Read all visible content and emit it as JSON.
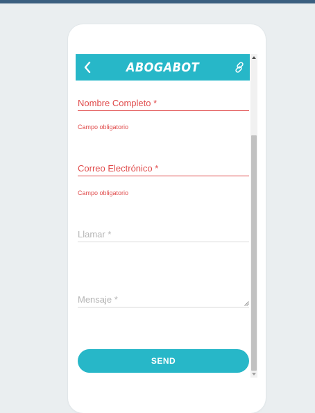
{
  "app": {
    "title": "ABOGABOT",
    "accent_color": "#27b7c8",
    "error_color": "#e04a4a",
    "back_icon": "chevron-left-icon",
    "link_icon": "link-icon"
  },
  "form": {
    "fields": [
      {
        "label": "Nombre Completo *",
        "error": "Campo obligatorio",
        "state": "error"
      },
      {
        "label": "Correo Electrónico *",
        "error": "Campo obligatorio",
        "state": "error"
      },
      {
        "label": "Llamar *",
        "state": "empty"
      },
      {
        "label": "Mensaje *",
        "state": "empty",
        "multiline": true
      }
    ],
    "submit_label": "SEND"
  },
  "scrollbar": {
    "position_fraction": 0.24,
    "visible_fraction": 0.76
  }
}
